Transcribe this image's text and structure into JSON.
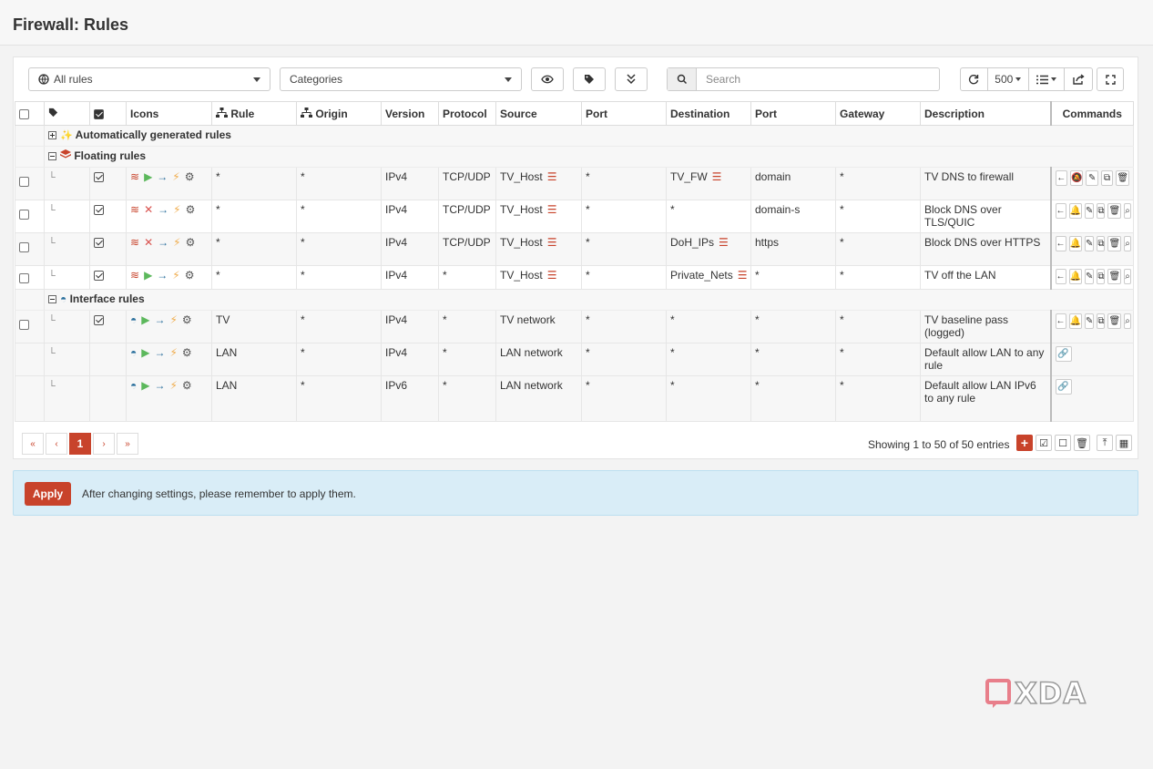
{
  "title": "Firewall: Rules",
  "toolbar": {
    "filter_selected": "All rules",
    "categories_placeholder": "Categories",
    "search_placeholder": "Search",
    "page_size": "500"
  },
  "columns": [
    "Icons",
    "Rule",
    "Origin",
    "Version",
    "Protocol",
    "Source",
    "Port",
    "Destination",
    "Port",
    "Gateway",
    "Description",
    "Commands"
  ],
  "groups": {
    "auto": "Automatically generated rules",
    "floating": "Floating rules",
    "interface": "Interface rules"
  },
  "rows": [
    {
      "rule": "*",
      "origin": "*",
      "version": "IPv4",
      "protocol": "TCP/UDP",
      "source": "TV_Host",
      "sport": "*",
      "destination": "TV_FW",
      "dport": "domain",
      "gateway": "*",
      "description": "TV DNS to firewall"
    },
    {
      "rule": "*",
      "origin": "*",
      "version": "IPv4",
      "protocol": "TCP/UDP",
      "source": "TV_Host",
      "sport": "*",
      "destination": "*",
      "dport": "domain-s",
      "gateway": "*",
      "description": "Block DNS over TLS/QUIC"
    },
    {
      "rule": "*",
      "origin": "*",
      "version": "IPv4",
      "protocol": "TCP/UDP",
      "source": "TV_Host",
      "sport": "*",
      "destination": "DoH_IPs",
      "dport": "https",
      "gateway": "*",
      "description": "Block DNS over HTTPS"
    },
    {
      "rule": "*",
      "origin": "*",
      "version": "IPv4",
      "protocol": "*",
      "source": "TV_Host",
      "sport": "*",
      "destination": "Private_Nets",
      "dport": "*",
      "gateway": "*",
      "description": "TV off the LAN"
    },
    {
      "rule": "TV",
      "origin": "*",
      "version": "IPv4",
      "protocol": "*",
      "source": "TV network",
      "sport": "*",
      "destination": "*",
      "dport": "*",
      "gateway": "*",
      "description": "TV baseline pass (logged)"
    },
    {
      "rule": "LAN",
      "origin": "*",
      "version": "IPv4",
      "protocol": "*",
      "source": "LAN network",
      "sport": "*",
      "destination": "*",
      "dport": "*",
      "gateway": "*",
      "description": "Default allow LAN to any rule"
    },
    {
      "rule": "LAN",
      "origin": "*",
      "version": "IPv6",
      "protocol": "*",
      "source": "LAN network",
      "sport": "*",
      "destination": "*",
      "dport": "*",
      "gateway": "*",
      "description": "Default allow LAN IPv6 to any rule"
    }
  ],
  "pagination": {
    "first": "«",
    "prev": "‹",
    "current": "1",
    "next": "›",
    "last": "»"
  },
  "showing": "Showing 1 to 50 of 50 entries",
  "apply": {
    "button": "Apply",
    "message": "After changing settings, please remember to apply them."
  },
  "logo": "XDA",
  "colors": {
    "accent": "#c8432b",
    "info_bg": "#d9edf7",
    "pass": "#5cb85c",
    "block": "#d9534f",
    "direction": "#2a6f9c",
    "quick": "#f0ad4e"
  }
}
